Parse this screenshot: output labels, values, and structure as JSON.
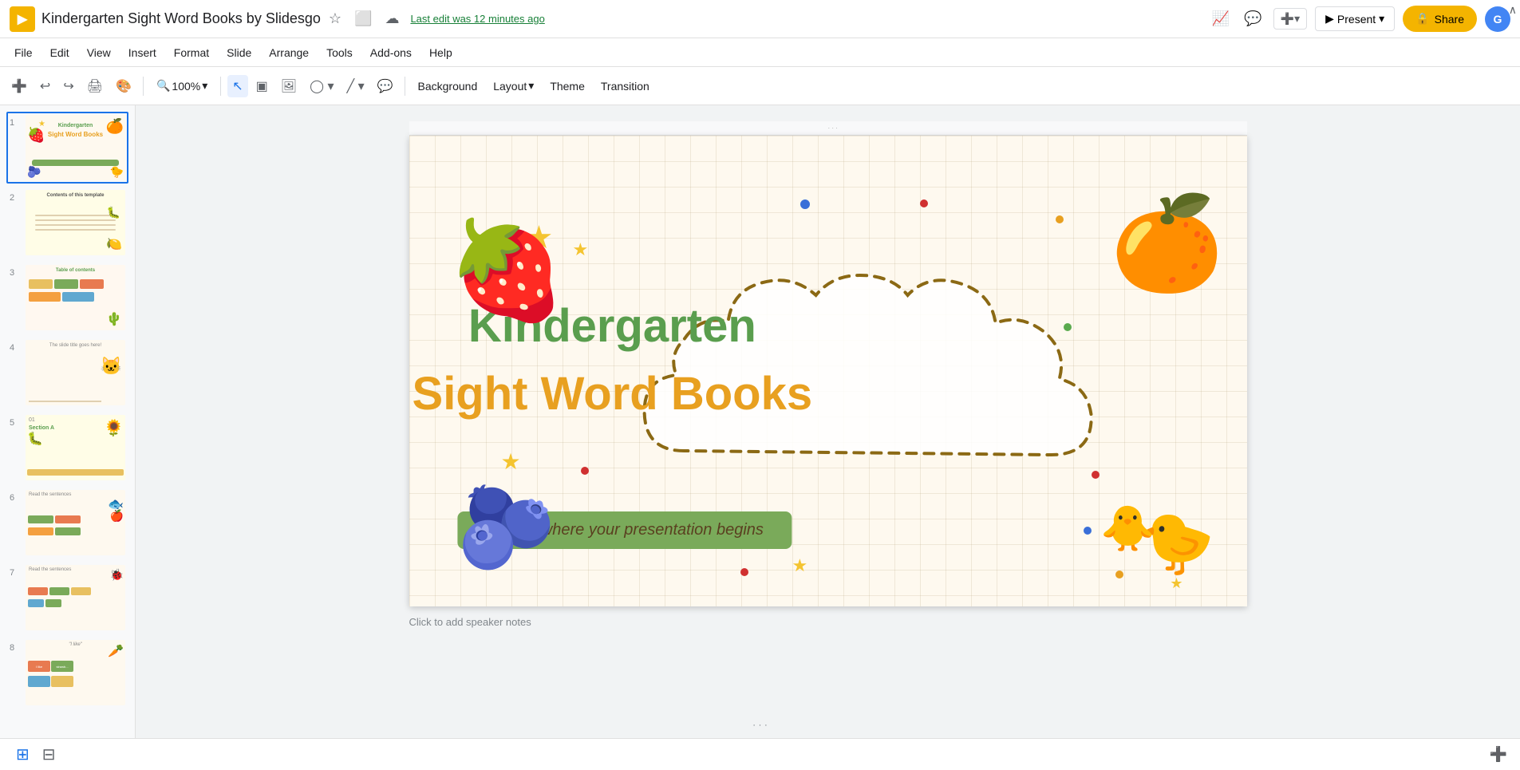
{
  "app": {
    "logo": "▶",
    "title": "Kindergarten Sight Word Books by Slidesgo",
    "autosave": "Last edit was 12 minutes ago"
  },
  "menu": {
    "items": [
      "File",
      "Edit",
      "View",
      "Insert",
      "Format",
      "Slide",
      "Arrange",
      "Tools",
      "Add-ons",
      "Help"
    ]
  },
  "toolbar": {
    "zoom_label": "100%",
    "background_label": "Background",
    "layout_label": "Layout",
    "theme_label": "Theme",
    "transition_label": "Transition"
  },
  "header_buttons": {
    "present": "Present",
    "share": "Share",
    "share_icon": "🔒"
  },
  "slide": {
    "title_green": "Kindergarten",
    "title_orange": "Sight Word Books",
    "subtitle": "Here is where your presentation begins"
  },
  "speaker_notes": "Click to add speaker notes",
  "slides": [
    {
      "num": "1",
      "active": true
    },
    {
      "num": "2",
      "active": false
    },
    {
      "num": "3",
      "active": false
    },
    {
      "num": "4",
      "active": false
    },
    {
      "num": "5",
      "active": false
    },
    {
      "num": "6",
      "active": false
    },
    {
      "num": "7",
      "active": false
    },
    {
      "num": "8",
      "active": false
    }
  ]
}
